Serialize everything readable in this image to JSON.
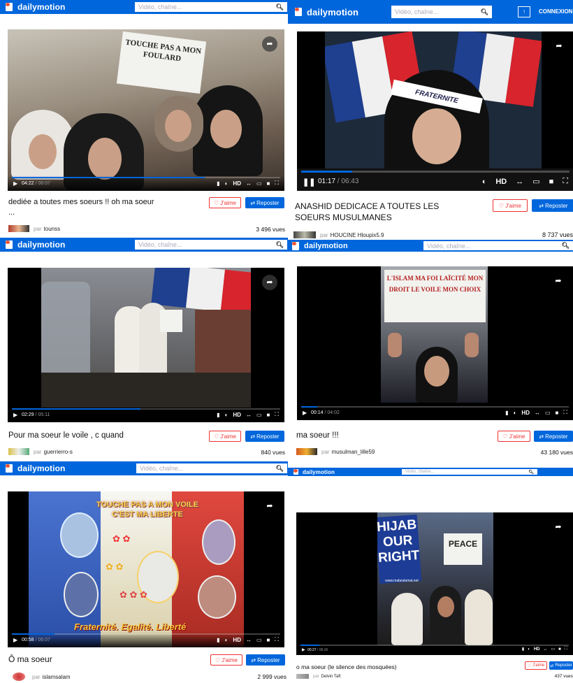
{
  "brand": "dailymotion",
  "search_placeholder": "Vidéo, chaîne...",
  "header_extra": {
    "upload_icon": "upload-arrow-icon",
    "login_label": "CONNEXION"
  },
  "controls": {
    "hd_label": "HD"
  },
  "buttons": {
    "like_label": "J'aime",
    "repost_label": "Reposter"
  },
  "owner_prefix": "par",
  "videos": [
    {
      "title": "dediée a toutes mes soeurs !! oh ma soeur",
      "title_more": "...",
      "current_time": "04:22",
      "duration": "06:07",
      "progress": 0.72,
      "owner": "tounss",
      "views": "3 496 vues"
    },
    {
      "title": "ANASHID DEDICACE A TOUTES LES SOEURS MUSULMANES",
      "current_time": "01:17",
      "duration": "06:43",
      "progress": 0.19,
      "owner": "HOUCINE Hloupix5.9",
      "views": "8 737 vues"
    },
    {
      "title": "Pour ma soeur le voile , c quand",
      "current_time": "02:29",
      "duration": "05:11",
      "progress": 0.48,
      "owner": "guerrierro-s",
      "views": "840 vues"
    },
    {
      "title": "ma soeur !!!",
      "current_time": "00:14",
      "duration": "04:02",
      "progress": 0.06,
      "owner": "musulman_lille59",
      "views": "43 180 vues"
    },
    {
      "title": "Ô ma soeur",
      "current_time": "00:58",
      "duration": "06:07",
      "progress": 0.16,
      "owner": "islamsalam",
      "views": "2 999 vues"
    },
    {
      "title": "o ma soeur (le silence des mosquées)",
      "current_time": "00:27",
      "duration": "06:16",
      "progress": 0.07,
      "owner": "Delvin Taft",
      "views": "437 vues"
    }
  ],
  "thumb_text": {
    "v1_sign": "TOUCHE PAS A MON FOULARD",
    "v2_band": "FRATERNITE",
    "v4_sign": "L'ISLAM MA FOI LAÏCITÉ MON DROIT LE VOILE MON CHOIX",
    "v5_title": "TOUCHE PAS A MON VOILE C'EST MA LIBERTE",
    "v5_motto": "Fraternité. Egalité. Liberté",
    "v6_sign": "HIJAB OUR RIGHT",
    "v6_url": "www.mabeslamat.net",
    "v6_small": "PEACE"
  }
}
